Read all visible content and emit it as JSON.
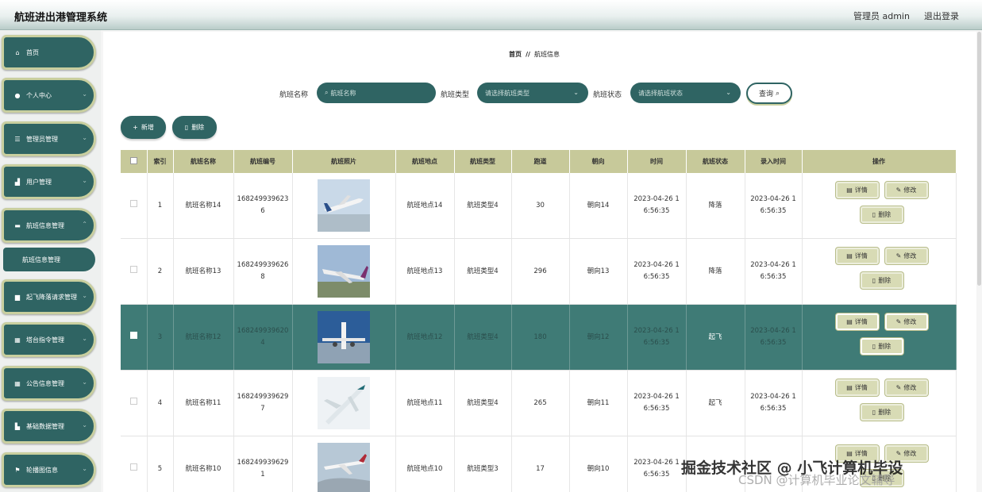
{
  "header": {
    "app_title": "航班进出港管理系统",
    "admin_label": "管理员 admin",
    "logout_label": "退出登录"
  },
  "sidebar": {
    "items": [
      {
        "label": "首页",
        "icon": "home-icon"
      },
      {
        "label": "个人中心",
        "icon": "user-icon"
      },
      {
        "label": "管理员管理",
        "icon": "list-icon"
      },
      {
        "label": "用户管理",
        "icon": "thumb-icon"
      },
      {
        "label": "航班信息管理",
        "icon": "database-icon"
      },
      {
        "label": "起飞降落请求管理",
        "icon": "briefcase-icon"
      },
      {
        "label": "塔台指令管理",
        "icon": "grid-icon"
      },
      {
        "label": "公告信息管理",
        "icon": "grid-icon"
      },
      {
        "label": "基础数据管理",
        "icon": "chart-icon"
      },
      {
        "label": "轮播图信息",
        "icon": "flag-icon"
      }
    ],
    "active_sub": "航班信息管理"
  },
  "breadcrumb": {
    "home": "首页",
    "sep": "//",
    "current": "航班信息"
  },
  "search": {
    "name_label": "航班名称",
    "name_placeholder": "航班名称",
    "type_label": "航班类型",
    "type_placeholder": "请选择航班类型",
    "status_label": "航班状态",
    "status_placeholder": "请选择航班状态",
    "query_label": "查询"
  },
  "actions": {
    "add_label": "新增",
    "delete_label": "删除"
  },
  "table": {
    "headers": [
      "",
      "索引",
      "航班名称",
      "航班编号",
      "航班照片",
      "航班地点",
      "航班类型",
      "跑道",
      "朝向",
      "时间",
      "航班状态",
      "录入时间",
      "操作"
    ],
    "op_labels": {
      "detail": "详情",
      "edit": "修改",
      "delete": "删除"
    },
    "rows": [
      {
        "index": "1",
        "name": "航班名称14",
        "code": "1682499396236",
        "location": "航班地点14",
        "type": "航班类型4",
        "runway": "30",
        "heading": "朝向14",
        "time": "2023-04-26 16:56:35",
        "status": "降落",
        "created": "2023-04-26 16:56:35"
      },
      {
        "index": "2",
        "name": "航班名称13",
        "code": "1682499396268",
        "location": "航班地点13",
        "type": "航班类型4",
        "runway": "296",
        "heading": "朝向13",
        "time": "2023-04-26 16:56:35",
        "status": "降落",
        "created": "2023-04-26 16:56:35"
      },
      {
        "index": "3",
        "name": "航班名称12",
        "code": "1682499396204",
        "location": "航班地点12",
        "type": "航班类型4",
        "runway": "180",
        "heading": "朝向12",
        "time": "2023-04-26 16:56:35",
        "status": "起飞",
        "created": "2023-04-26 16:56:35"
      },
      {
        "index": "4",
        "name": "航班名称11",
        "code": "1682499396297",
        "location": "航班地点11",
        "type": "航班类型4",
        "runway": "265",
        "heading": "朝向11",
        "time": "2023-04-26 16:56:35",
        "status": "起飞",
        "created": "2023-04-26 16:56:35"
      },
      {
        "index": "5",
        "name": "航班名称10",
        "code": "1682499396291",
        "location": "航班地点10",
        "type": "航班类型3",
        "runway": "17",
        "heading": "朝向10",
        "time": "2023-04-26 16:56:35",
        "status": "",
        "created": ""
      }
    ]
  },
  "watermark": {
    "line1": "掘金技术社区 @ 小飞计算机毕设",
    "line2": "CSDN @计算机毕业论文辅导"
  },
  "colors": {
    "primary": "#2f6463",
    "accent": "#c7c99a",
    "highlight_row": "#3f7b76"
  }
}
